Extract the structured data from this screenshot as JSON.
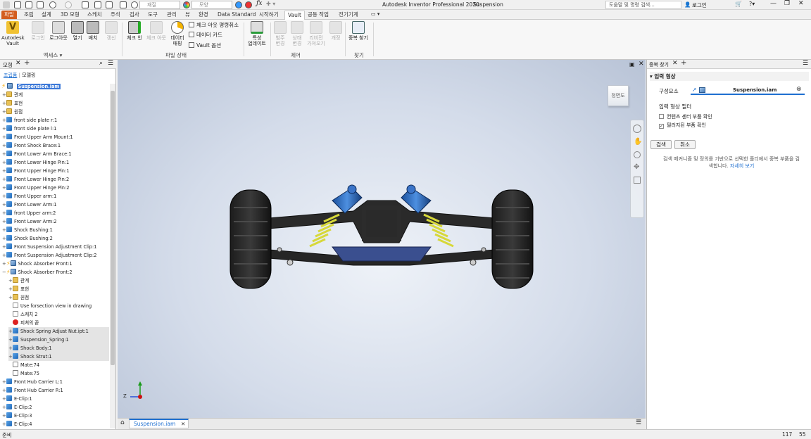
{
  "app": {
    "title": "Autodesk Inventor Professional 2020",
    "document": "Suspension",
    "search_placeholder": "도움말 및 명령 검색...",
    "login": "로그인",
    "material_combo": "재질",
    "appearance_combo": "모양"
  },
  "menu_tabs": [
    "파일",
    "조립",
    "설계",
    "3D 모형",
    "스케치",
    "주석",
    "검사",
    "도구",
    "관리",
    "뷰",
    "환경",
    "Data Standard",
    "시작하기",
    "Vault",
    "공동 작업",
    "전기기계"
  ],
  "ribbon": {
    "access": {
      "vault": "Autodesk\nVault",
      "login": "로그인",
      "logout": "로그아웃",
      "open": "열기",
      "place": "배치",
      "refresh": "갱신",
      "label": "액세스 ▾"
    },
    "file_status": {
      "checkin": "체크 인",
      "checkout": "체크 아웃",
      "data_mapping": "데이터\n매핑",
      "undo_checkout": "체크 아웃 명령취소",
      "data_card": "데이터 카드",
      "vault_options": "Vault 옵션",
      "label": "파일 상태"
    },
    "update": {
      "attr_update": "특성\n업데이트"
    },
    "control": {
      "category_change": "범주\n변경",
      "state_change": "상태\n변경",
      "revision": "리비전\n가져오기",
      "change": "개정",
      "label": "제어"
    },
    "find": {
      "dup_find": "중복 찾기",
      "label": "찾기"
    }
  },
  "browser": {
    "tab": "모형",
    "tab_assembly": "조립품",
    "tab_modeling": "모델링",
    "root": "Suspension.iam",
    "items": [
      {
        "label": "관계",
        "icon": "folder",
        "indent": 1,
        "exp": "+"
      },
      {
        "label": "표현",
        "icon": "folder",
        "indent": 1,
        "exp": "+"
      },
      {
        "label": "원점",
        "icon": "folder",
        "indent": 1,
        "exp": "+"
      },
      {
        "label": "front side plate r:1",
        "icon": "part",
        "indent": 1,
        "exp": "+"
      },
      {
        "label": "front side plate l:1",
        "icon": "part",
        "indent": 1,
        "exp": "+"
      },
      {
        "label": "Front Upper Arm Mount:1",
        "icon": "part",
        "indent": 1,
        "exp": "+"
      },
      {
        "label": "Front Shock Brace:1",
        "icon": "part",
        "indent": 1,
        "exp": "+"
      },
      {
        "label": "Front Lower Arm Brace:1",
        "icon": "part",
        "indent": 1,
        "exp": "+"
      },
      {
        "label": "Front Lower Hinge Pin:1",
        "icon": "part",
        "indent": 1,
        "exp": "+"
      },
      {
        "label": "Front Upper Hinge Pin:1",
        "icon": "part",
        "indent": 1,
        "exp": "+"
      },
      {
        "label": "Front Lower Hinge Pin:2",
        "icon": "part",
        "indent": 1,
        "exp": "+"
      },
      {
        "label": "Front Upper Hinge Pin:2",
        "icon": "part",
        "indent": 1,
        "exp": "+"
      },
      {
        "label": "Front Upper arm:1",
        "icon": "part",
        "indent": 1,
        "exp": "+"
      },
      {
        "label": "Front Lower Arm:1",
        "icon": "part",
        "indent": 1,
        "exp": "+"
      },
      {
        "label": "front Upper arm:2",
        "icon": "part",
        "indent": 1,
        "exp": "+"
      },
      {
        "label": "Front Lower Arm:2",
        "icon": "part",
        "indent": 1,
        "exp": "+"
      },
      {
        "label": "Shock Bushing:1",
        "icon": "part",
        "indent": 1,
        "exp": "+"
      },
      {
        "label": "Shock Bushing:2",
        "icon": "part",
        "indent": 1,
        "exp": "+"
      },
      {
        "label": "Front Suspension Adjustment Clip:1",
        "icon": "part",
        "indent": 1,
        "exp": "+"
      },
      {
        "label": "Front Suspension Adjustment Clip:2",
        "icon": "part",
        "indent": 1,
        "exp": "+"
      },
      {
        "label": "Shock Absorber Front:1",
        "icon": "asm",
        "indent": 1,
        "exp": "+",
        "bolt": true
      },
      {
        "label": "Shock Absorber Front:2",
        "icon": "asm",
        "indent": 1,
        "exp": "−",
        "bolt": true
      },
      {
        "label": "관계",
        "icon": "folder",
        "indent": 2,
        "exp": "+"
      },
      {
        "label": "표현",
        "icon": "folder",
        "indent": 2,
        "exp": "+"
      },
      {
        "label": "원점",
        "icon": "folder",
        "indent": 2,
        "exp": "+"
      },
      {
        "label": "Use forsection view in drawing",
        "icon": "sketch",
        "indent": 2,
        "exp": ""
      },
      {
        "label": "스케치 2",
        "icon": "sketch",
        "indent": 2,
        "exp": ""
      },
      {
        "label": "피쳐의 끝",
        "icon": "err",
        "indent": 2,
        "exp": ""
      },
      {
        "label": "Shock Spring Adjust Nut.ipt:1",
        "icon": "part",
        "indent": 2,
        "exp": "+",
        "sel": true
      },
      {
        "label": "Suspension_Spring:1",
        "icon": "part",
        "indent": 2,
        "exp": "+",
        "sel": true
      },
      {
        "label": "Shock Body:1",
        "icon": "part",
        "indent": 2,
        "exp": "+",
        "sel": true
      },
      {
        "label": "Shock Strut:1",
        "icon": "part",
        "indent": 2,
        "exp": "+",
        "sel": true
      },
      {
        "label": "Mate:74",
        "icon": "mate",
        "indent": 2,
        "exp": ""
      },
      {
        "label": "Mate:75",
        "icon": "mate",
        "indent": 2,
        "exp": ""
      },
      {
        "label": "Front Hub Carrier L:1",
        "icon": "part",
        "indent": 1,
        "exp": "+"
      },
      {
        "label": "Front Hub Carrier R:1",
        "icon": "part",
        "indent": 1,
        "exp": "+"
      },
      {
        "label": "E-Clip:1",
        "icon": "part",
        "indent": 1,
        "exp": "+"
      },
      {
        "label": "E-Clip:2",
        "icon": "part",
        "indent": 1,
        "exp": "+"
      },
      {
        "label": "E-Clip:3",
        "icon": "part",
        "indent": 1,
        "exp": "+"
      },
      {
        "label": "E-Clip:4",
        "icon": "part",
        "indent": 1,
        "exp": "+"
      }
    ]
  },
  "viewport": {
    "viewcube_label": "정면도",
    "doc_tab": "Suspension.iam",
    "axis_z": "Z",
    "axis_x": "X"
  },
  "right_panel": {
    "tab": "중복 찾기",
    "section": "입력 형상",
    "component_label": "구성요소",
    "component_value": "Suspension.iam",
    "filter_label": "입력 형상 필터",
    "filter1": "컨텐츠 센터 부품 확인",
    "filter1_checked": false,
    "filter2": "필러지된 부품 확인",
    "filter2_checked": true,
    "search_btn": "검색",
    "cancel_btn": "취소",
    "desc": "검색 메커니즘 및 정의를 기반으로 선택한 폴더에서 중복 부품을 검색합니다.",
    "desc_link": "자세히 보기"
  },
  "status": {
    "ready": "준비",
    "num1": "117",
    "num2": "55"
  },
  "colors": {
    "file_tab": "#d35d1e",
    "accent": "#1e6fd0"
  }
}
